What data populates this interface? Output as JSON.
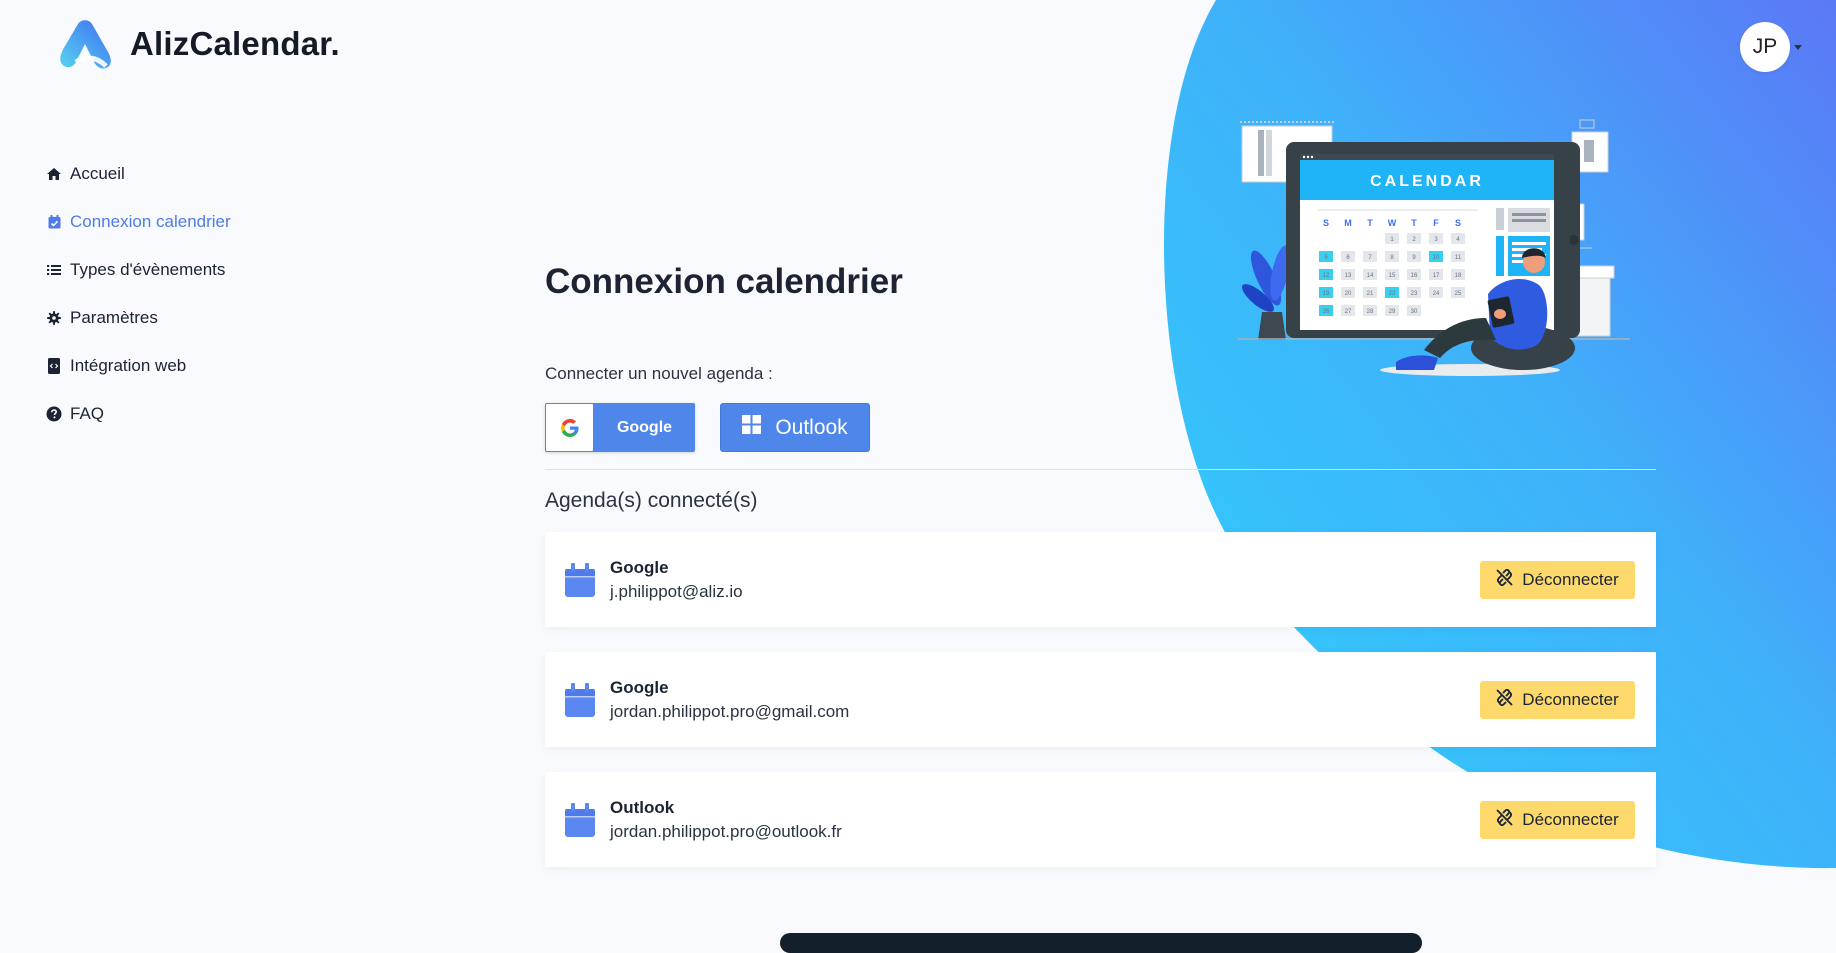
{
  "app": {
    "name": "AlizCalendar."
  },
  "user": {
    "initials": "JP"
  },
  "sidebar": {
    "items": [
      {
        "label": "Accueil",
        "icon": "home-icon",
        "active": false
      },
      {
        "label": "Connexion calendrier",
        "icon": "calendar-check-icon",
        "active": true
      },
      {
        "label": "Types d'évènements",
        "icon": "list-icon",
        "active": false
      },
      {
        "label": "Paramètres",
        "icon": "gear-icon",
        "active": false
      },
      {
        "label": "Intégration web",
        "icon": "code-file-icon",
        "active": false
      },
      {
        "label": "FAQ",
        "icon": "question-circle-icon",
        "active": false
      }
    ]
  },
  "main": {
    "title": "Connexion calendrier",
    "connect_prompt": "Connecter un nouvel agenda :",
    "google_button": "Google",
    "outlook_button": "Outlook",
    "connected_title": "Agenda(s) connecté(s)",
    "calendars": [
      {
        "provider": "Google",
        "email": "j.philippot@aliz.io",
        "action": "Déconnecter"
      },
      {
        "provider": "Google",
        "email": "jordan.philippot.pro@gmail.com",
        "action": "Déconnecter"
      },
      {
        "provider": "Outlook",
        "email": "jordan.philippot.pro@outlook.fr",
        "action": "Déconnecter"
      }
    ]
  },
  "illustration": {
    "calendar_title": "CALENDAR",
    "weekdays": [
      "S",
      "M",
      "T",
      "W",
      "T",
      "F",
      "S"
    ],
    "days": [
      "1",
      "2",
      "3",
      "4",
      "5",
      "6",
      "7",
      "8",
      "9",
      "10",
      "11",
      "12",
      "13",
      "14",
      "15",
      "16",
      "17",
      "18",
      "19",
      "20",
      "21",
      "22",
      "23",
      "24",
      "25",
      "26",
      "27",
      "28",
      "29",
      "30"
    ]
  },
  "colors": {
    "accent": "#4f7bea",
    "button_blue": "#4e86ea",
    "warning_yellow": "#fcd96a",
    "blob_light": "#34c6fb",
    "blob_dark": "#5a7cf6"
  }
}
